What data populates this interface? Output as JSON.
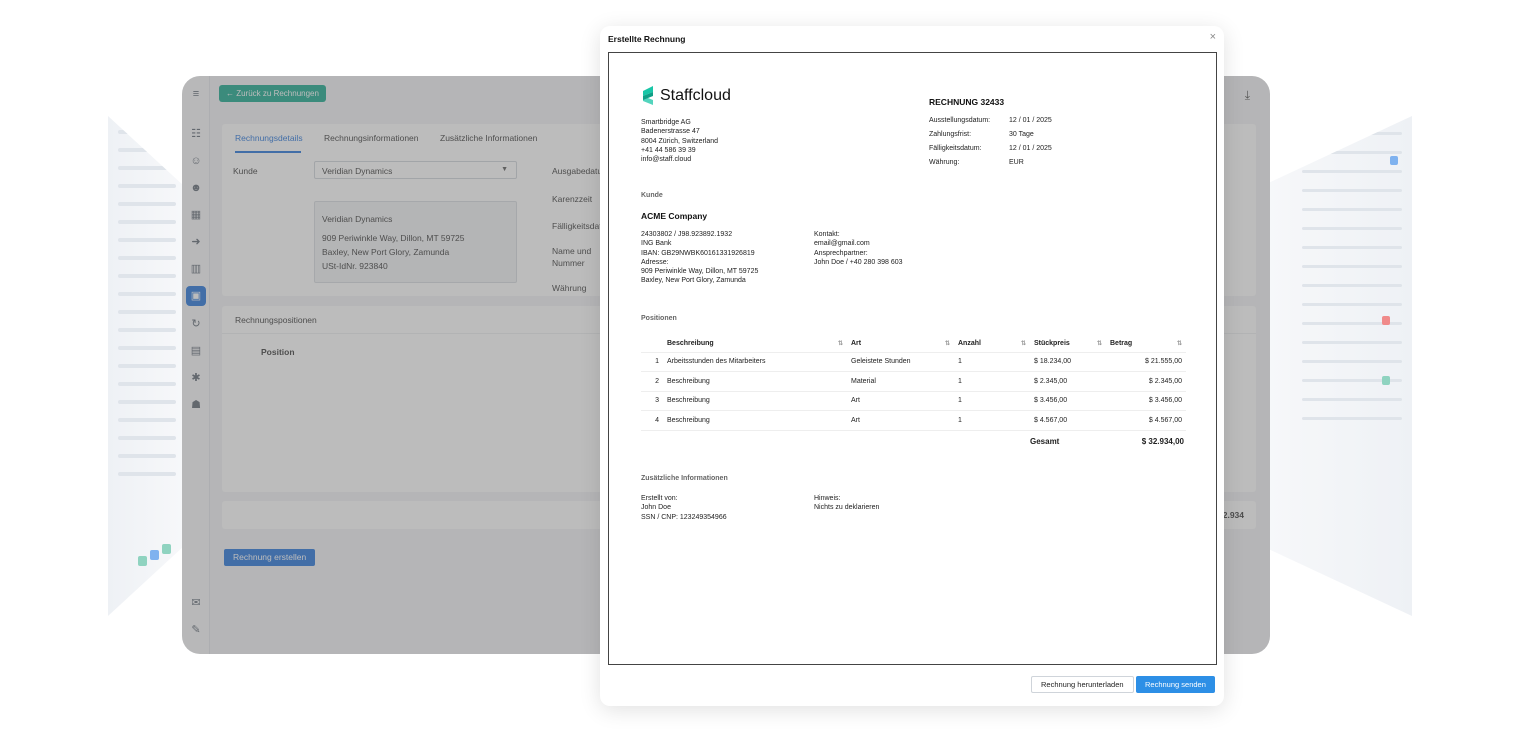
{
  "app": {
    "back_label": "← Zurück zu Rechnungen",
    "tabs": [
      "Rechnungsdetails",
      "Rechnungsinformationen",
      "Zusätzliche Informationen"
    ],
    "customer_label": "Kunde",
    "customer_value": "Veridian Dynamics",
    "address_box": [
      "Veridian Dynamics",
      "909 Periwinkle Way, Dillon, MT 59725",
      "Baxley, New Port Glory, Zamunda",
      "USt-IdNr. 923840"
    ],
    "right_labels": [
      "Ausgabedatu",
      "Karenzzeit",
      "Fälligkeitsdat",
      "Name und",
      "Nummer",
      "Währung"
    ],
    "positions_section": "Rechnungspositionen",
    "position_col": "Position",
    "total_fragment": "32.934",
    "create_button": "Rechnung erstellen",
    "sidebar_icons": [
      "menu-icon",
      "org-chart-icon",
      "people-icon",
      "user-add-icon",
      "calendar-icon",
      "login-icon",
      "building-icon",
      "invoice-icon",
      "sync-icon",
      "document-icon",
      "settings-icon",
      "user-key-icon",
      "announcement-icon",
      "chat-icon"
    ]
  },
  "modal": {
    "title": "Erstellte Rechnung",
    "download_button": "Rechnung herunterladen",
    "send_button": "Rechnung senden"
  },
  "invoice": {
    "logo_text": "Staffcloud",
    "sender_lines": [
      "Smartbridge AG",
      "Badenerstrasse 47",
      "8004 Zürich, Switzerland",
      "+41 44 586 39 39",
      "info@staff.cloud"
    ],
    "number_title": "RECHNUNG 32433",
    "meta": [
      {
        "k": "Ausstellungsdatum:",
        "v": "12 / 01 / 2025"
      },
      {
        "k": "Zahlungsfrist:",
        "v": "30 Tage"
      },
      {
        "k": "Fälligkeitsdatum:",
        "v": "12 / 01 / 2025"
      },
      {
        "k": "Währung:",
        "v": "EUR"
      }
    ],
    "customer_heading": "Kunde",
    "customer_name": "ACME Company",
    "customer_lines": [
      "24303802 / J98.923892.1932",
      "ING Bank",
      "IBAN: GB29NWBK60161331926819",
      "Adresse:",
      "909 Periwinkle Way, Dillon, MT 59725",
      "Baxley, New Port Glory, Zamunda"
    ],
    "contact_lines": [
      "Kontakt:",
      "email@gmail.com",
      "Ansprechpartner:",
      "John Doe / +40 280 398 603"
    ],
    "positions_heading": "Positionen",
    "columns": [
      "Beschreibung",
      "Art",
      "Anzahl",
      "Stückpreis",
      "Betrag"
    ],
    "rows": [
      {
        "n": "1",
        "desc": "Arbeitsstunden des Mitarbeiters",
        "art": "Geleistete Stunden",
        "qty": "1",
        "price": "$ 18.234,00",
        "amount": "$ 21.555,00"
      },
      {
        "n": "2",
        "desc": "Beschreibung",
        "art": "Material",
        "qty": "1",
        "price": "$ 2.345,00",
        "amount": "$ 2.345,00"
      },
      {
        "n": "3",
        "desc": "Beschreibung",
        "art": "Art",
        "qty": "1",
        "price": "$ 3.456,00",
        "amount": "$ 3.456,00"
      },
      {
        "n": "4",
        "desc": "Beschreibung",
        "art": "Art",
        "qty": "1",
        "price": "$ 4.567,00",
        "amount": "$ 4.567,00"
      }
    ],
    "total_label": "Gesamt",
    "total_value": "$ 32.934,00",
    "extra_heading": "Zusätzliche Informationen",
    "created_lines": [
      "Erstellt von:",
      "John Doe",
      "SSN / CNP: 123249354966"
    ],
    "note_lines": [
      "Hinweis:",
      "Nichts zu deklarieren"
    ]
  },
  "colors": {
    "brand_green": "#12a58a",
    "primary_blue": "#1e6fd9",
    "send_blue": "#2d8fe6",
    "logo_teal": "#19c6a7"
  }
}
